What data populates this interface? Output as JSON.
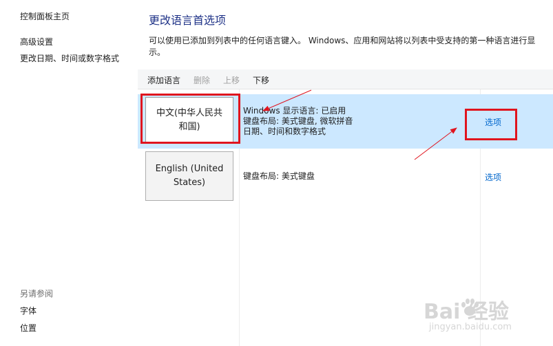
{
  "sidebar": {
    "home": "控制面板主页",
    "advanced": "高级设置",
    "datetime": "更改日期、时间或数字格式",
    "see_also": "另请参阅",
    "fonts": "字体",
    "location": "位置"
  },
  "main": {
    "title": "更改语言首选项",
    "description": "可以使用已添加到列表中的任何语言键入。 Windows、应用和网站将以列表中受支持的第一种语言进行显示。"
  },
  "toolbar": {
    "add": "添加语言",
    "remove": "删除",
    "up": "上移",
    "down": "下移"
  },
  "languages": [
    {
      "name_line1": "中文(中华人民共",
      "name_line2": "和国)",
      "info_line1": "Windows 显示语言: 已启用",
      "info_line2": "键盘布局: 美式键盘, 微软拼音",
      "info_line3": "日期、时间和数字格式",
      "options": "选项",
      "selected": true
    },
    {
      "name_line1": "English (United",
      "name_line2": "States)",
      "info_line1": "键盘布局: 美式键盘",
      "options": "选项",
      "selected": false
    }
  ],
  "watermark": {
    "brand": "Bai  经验",
    "site": "jingyan.baidu.com"
  },
  "colors": {
    "title": "#1e3287",
    "link": "#0066cc",
    "selection": "#cce8ff",
    "annotation": "#e0141e"
  }
}
